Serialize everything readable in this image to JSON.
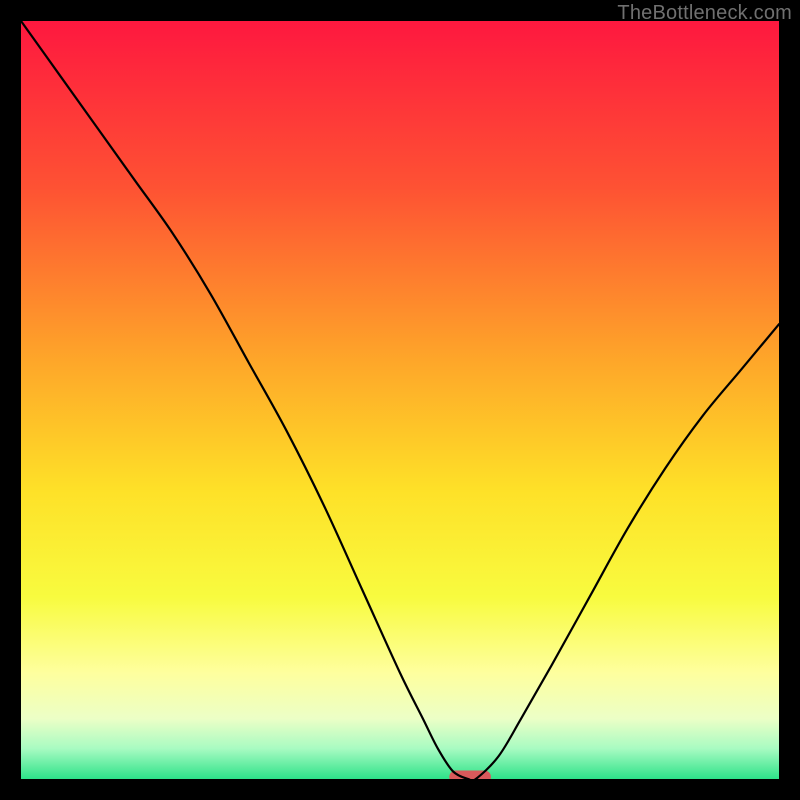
{
  "watermark": {
    "text": "TheBottleneck.com"
  },
  "chart_data": {
    "type": "line",
    "title": "",
    "xlabel": "",
    "ylabel": "",
    "xlim": [
      0,
      100
    ],
    "ylim": [
      0,
      100
    ],
    "grid": false,
    "legend": false,
    "x": [
      0,
      5,
      10,
      15,
      20,
      25,
      30,
      35,
      40,
      45,
      50,
      53,
      55,
      57,
      59,
      60,
      63,
      66,
      70,
      75,
      80,
      85,
      90,
      95,
      100
    ],
    "values": [
      100,
      93,
      86,
      79,
      72,
      64,
      55,
      46,
      36,
      25,
      14,
      8,
      4,
      1,
      0,
      0,
      3,
      8,
      15,
      24,
      33,
      41,
      48,
      54,
      60
    ],
    "marker": {
      "x_start": 56.5,
      "x_end": 62,
      "y": 0,
      "color": "#d9595b"
    },
    "background_gradient": {
      "type": "vertical",
      "stops": [
        {
          "pos": 0.0,
          "color": "#fe183f"
        },
        {
          "pos": 0.22,
          "color": "#fe5233"
        },
        {
          "pos": 0.45,
          "color": "#fea729"
        },
        {
          "pos": 0.62,
          "color": "#fee128"
        },
        {
          "pos": 0.76,
          "color": "#f8fb3f"
        },
        {
          "pos": 0.86,
          "color": "#feff9e"
        },
        {
          "pos": 0.92,
          "color": "#ecffc6"
        },
        {
          "pos": 0.96,
          "color": "#a8fbc2"
        },
        {
          "pos": 1.0,
          "color": "#2de289"
        }
      ]
    }
  }
}
